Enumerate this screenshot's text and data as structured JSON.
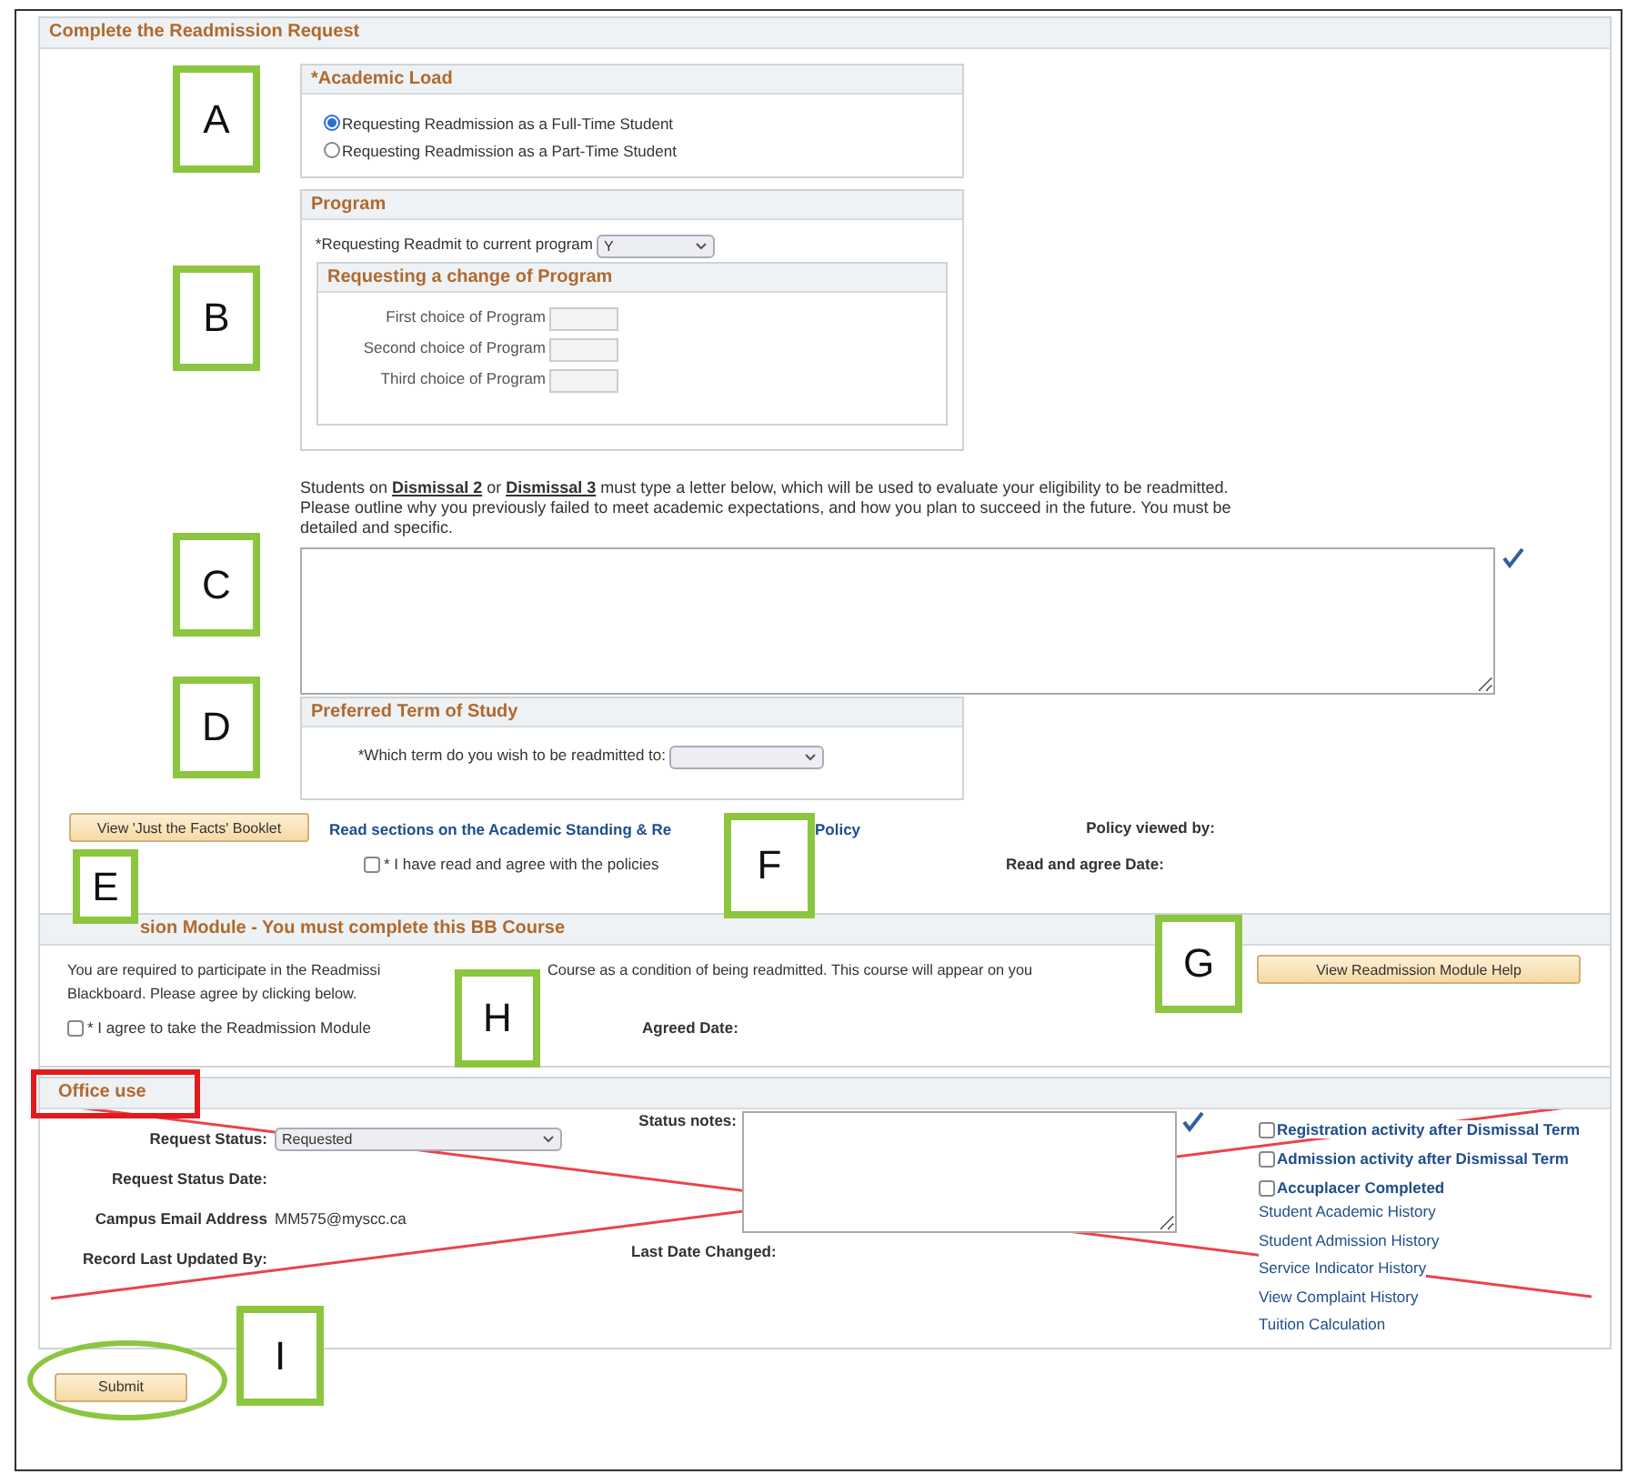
{
  "panel_title": "Complete the Readmission Request",
  "academic_load": {
    "title": "*Academic Load",
    "options": [
      {
        "label": "Requesting Readmission as a Full-Time Student",
        "selected": true
      },
      {
        "label": "Requesting Readmission as a Part-Time Student",
        "selected": false
      }
    ]
  },
  "program": {
    "title": "Program",
    "current_label": "*Requesting Readmit to current program",
    "current_value": "Y",
    "change_title": "Requesting a change of Program",
    "fields": [
      {
        "label": "First choice of Program"
      },
      {
        "label": "Second choice of Program"
      },
      {
        "label": "Third choice of Program"
      }
    ]
  },
  "letter": {
    "instructions": "Students on **Dismissal 2** or **Dismissal 3** must type a letter below, which will be used to evaluate your eligibility to be readmitted. Please outline why you previously failed to meet academic expectations, and how you plan to succeed in the future. You must be detailed and specific."
  },
  "term": {
    "title": "Preferred Term of Study",
    "label": "*Which term do you wish to be readmitted to:"
  },
  "policy": {
    "booklet_button": "View 'Just the Facts' Booklet",
    "link_parts": [
      "Read sections on the Academic Standing & Re",
      "Policy"
    ],
    "agree_label": "* I have read and agree with the policies",
    "agree_checked": false,
    "viewed_by": "Policy viewed by:",
    "agree_date": "Read and agree Date:"
  },
  "module": {
    "title": "sion Module - You must complete this BB Course",
    "text_parts": [
      "You are required to participate in the Readmissi",
      "Course as a condition of being readmitted. This course will appear on you"
    ],
    "text_line2": "Blackboard. Please agree by clicking below.",
    "help_button": "View Readmission Module Help",
    "agree_label": "* I agree to take the Readmission Module",
    "agree_checked": false,
    "agreed_date": "Agreed Date:"
  },
  "office": {
    "title": "Office use",
    "fields": [
      {
        "kind": "select",
        "label": "Request Status:",
        "value": "Requested"
      },
      {
        "kind": "text",
        "label": "Request Status Date:"
      },
      {
        "kind": "text",
        "label": "Campus Email Address",
        "value": "MM575@myscc.ca"
      },
      {
        "kind": "text",
        "label": "Record Last Updated By:"
      }
    ],
    "notes_label": "Status notes:",
    "last_changed": "Last Date Changed:",
    "checks": [
      {
        "label": "Registration activity after Dismissal Term",
        "checked": false
      },
      {
        "label": "Admission activity after Dismissal Term",
        "checked": false
      },
      {
        "label": "Accuplacer Completed",
        "checked": false
      }
    ],
    "links": [
      "Student Academic History",
      "Student Admission History",
      "Service Indicator History",
      "View Complaint History",
      "Tuition Calculation"
    ]
  },
  "submit": "Submit",
  "callouts": [
    "A",
    "B",
    "C",
    "D",
    "E",
    "F",
    "G",
    "H",
    "I"
  ]
}
